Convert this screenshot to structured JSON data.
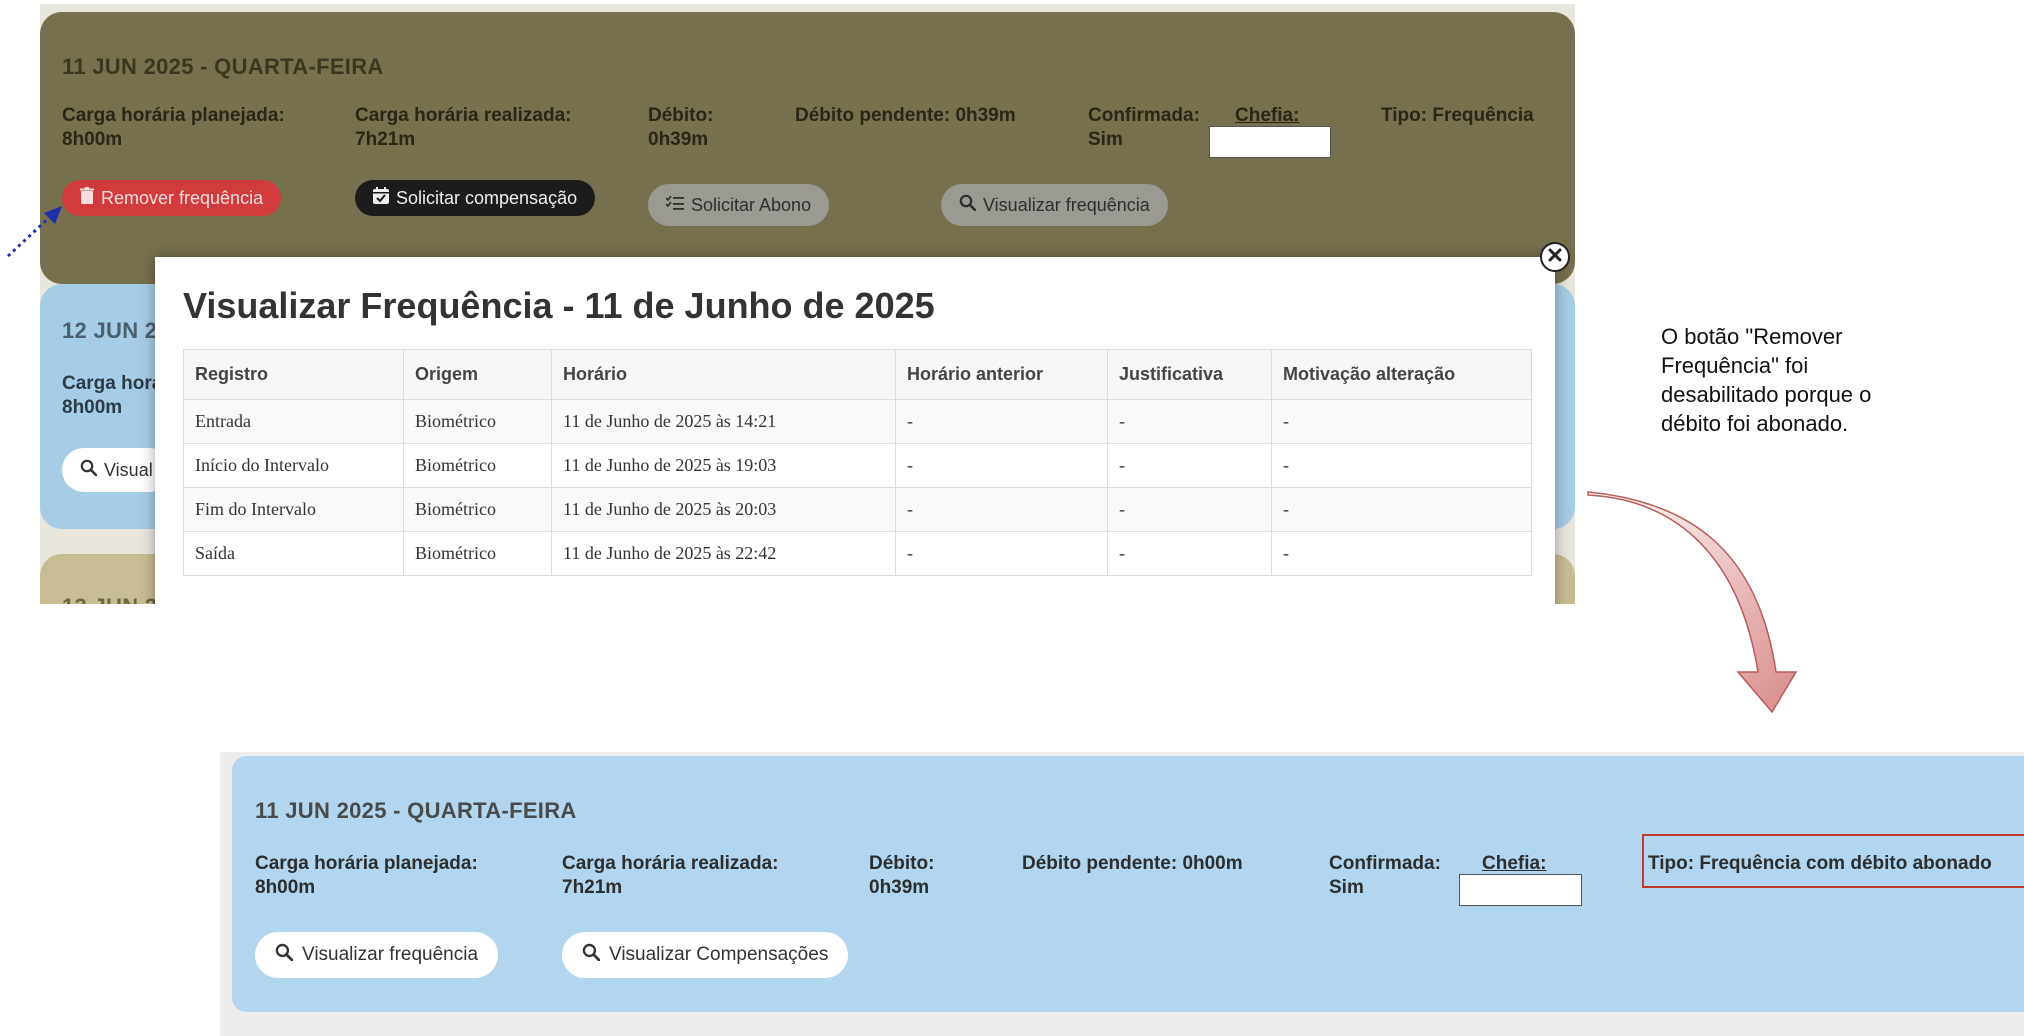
{
  "top": {
    "card1": {
      "title": "11 JUN 2025 - QUARTA-FEIRA",
      "planejada_label": "Carga horária planejada:",
      "planejada_value": "8h00m",
      "realizada_label": "Carga horária realizada:",
      "realizada_value": "7h21m",
      "debito_label": "Débito:",
      "debito_value": "0h39m",
      "debito_pendente": "Débito pendente: 0h39m",
      "confirmada_label": "Confirmada:",
      "confirmada_value": "Sim",
      "chefia_label": "Chefia:",
      "tipo": "Tipo: Frequência",
      "buttons": {
        "remover": "Remover frequência",
        "compensacao": "Solicitar compensação",
        "abono": "Solicitar Abono",
        "visualizar": "Visualizar frequência"
      }
    },
    "card2": {
      "title_partial": "12 JUN 2",
      "carga_partial": "Carga hora",
      "carga_value": "8h00m",
      "btn_partial": "Visual"
    },
    "card3": {
      "title_partial": "13 JUN 2"
    },
    "modal": {
      "title": "Visualizar Frequência - 11 de Junho de 2025",
      "columns": [
        "Registro",
        "Origem",
        "Horário",
        "Horário anterior",
        "Justificativa",
        "Motivação alteração"
      ],
      "rows": [
        [
          "Entrada",
          "Biométrico",
          "11 de Junho de 2025 às 14:21",
          "-",
          "-",
          "-"
        ],
        [
          "Início do Intervalo",
          "Biométrico",
          "11 de Junho de 2025 às 19:03",
          "-",
          "-",
          "-"
        ],
        [
          "Fim do Intervalo",
          "Biométrico",
          "11 de Junho de 2025 às 20:03",
          "-",
          "-",
          "-"
        ],
        [
          "Saída",
          "Biométrico",
          "11 de Junho de 2025 às 22:42",
          "-",
          "-",
          "-"
        ]
      ]
    }
  },
  "annotation": {
    "line1": "O botão \"Remover",
    "line2": "Frequência\" foi",
    "line3": "desabilitado porque o",
    "line4": "débito foi abonado."
  },
  "bottom": {
    "title": "11 JUN 2025 - QUARTA-FEIRA",
    "planejada_label": "Carga horária planejada:",
    "planejada_value": "8h00m",
    "realizada_label": "Carga horária realizada:",
    "realizada_value": "7h21m",
    "debito_label": "Débito:",
    "debito_value": "0h39m",
    "debito_pendente": "Débito pendente: 0h00m",
    "confirmada_label": "Confirmada:",
    "confirmada_value": "Sim",
    "chefia_label": "Chefia:",
    "tipo": "Tipo: Frequência com débito abonado",
    "buttons": {
      "visualizar_frequencia": "Visualizar frequência",
      "visualizar_compensacoes": "Visualizar Compensações"
    }
  },
  "colors": {
    "olive_card": "#77704f",
    "blue_card": "#a6cde6",
    "remove_button": "#d13b3b",
    "dark_button": "#1c1c1c",
    "gray_button": "#9a9a93",
    "highlight_border": "#c0392b",
    "annotation_arrow": "#1f2fa8",
    "curved_arrow": "#d98a8a"
  },
  "icons": [
    "trash-icon",
    "calendar-check-icon",
    "list-check-icon",
    "search-icon",
    "close-icon"
  ]
}
